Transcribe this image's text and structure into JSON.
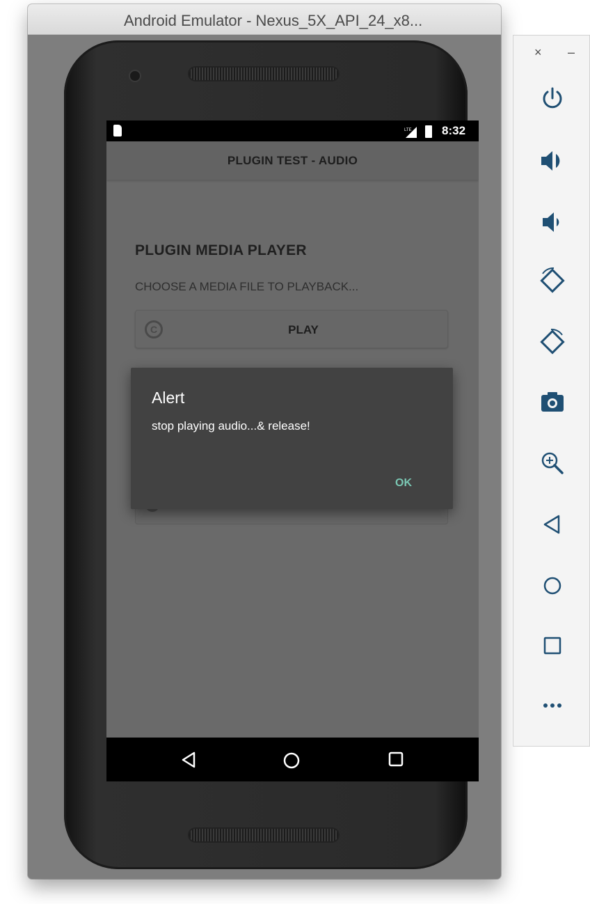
{
  "window": {
    "title": "Android Emulator - Nexus_5X_API_24_x8..."
  },
  "statusbar": {
    "time": "8:32",
    "network": "LTE"
  },
  "app": {
    "title": "PLUGIN TEST - AUDIO",
    "section_title": "PLUGIN MEDIA PLAYER",
    "section_subtitle": "CHOOSE A MEDIA FILE TO PLAYBACK...",
    "play_button": "PLAY"
  },
  "dialog": {
    "title": "Alert",
    "message": "stop playing audio...& release!",
    "ok_button": "OK"
  },
  "navbar": {
    "icons": [
      "back-icon",
      "home-icon",
      "recents-icon"
    ]
  },
  "emulator_panel": {
    "close_label": "×",
    "minimize_label": "–",
    "tools": [
      "power-icon",
      "volume-up-icon",
      "volume-down-icon",
      "rotate-left-icon",
      "rotate-right-icon",
      "camera-icon",
      "zoom-icon",
      "back-icon",
      "home-icon",
      "overview-icon",
      "more-icon"
    ]
  },
  "colors": {
    "accent": "#7ac7b3",
    "panel_icon": "#1f4f73",
    "dialog_bg": "#424242"
  }
}
